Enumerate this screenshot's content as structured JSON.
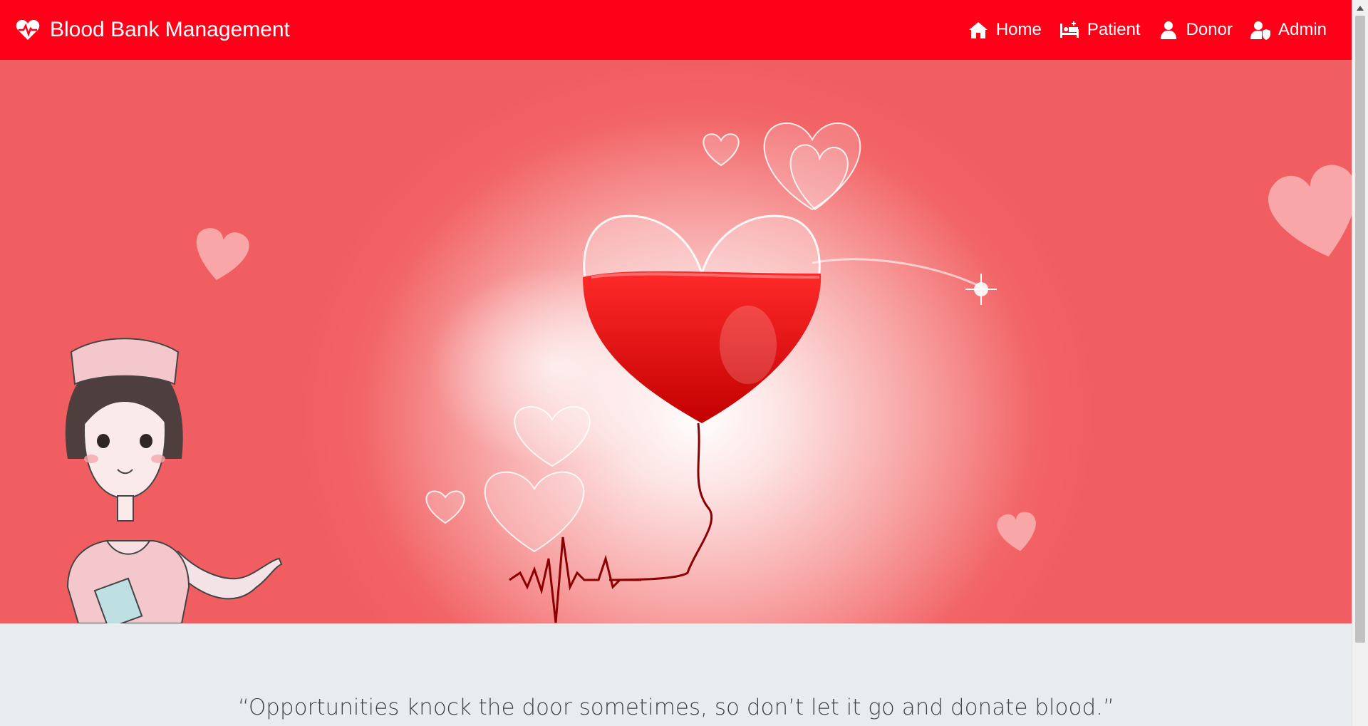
{
  "navbar": {
    "brand": "Blood Bank Management",
    "brand_icon": "heartbeat-icon",
    "bg_color": "#ff0019",
    "links": [
      {
        "label": "Home",
        "icon": "home-icon"
      },
      {
        "label": "Patient",
        "icon": "bed-icon"
      },
      {
        "label": "Donor",
        "icon": "user-icon"
      },
      {
        "label": "Admin",
        "icon": "user-shield-icon"
      }
    ]
  },
  "quote": "“Opportunities knock the door sometimes, so don’t let it go and donate blood.”"
}
